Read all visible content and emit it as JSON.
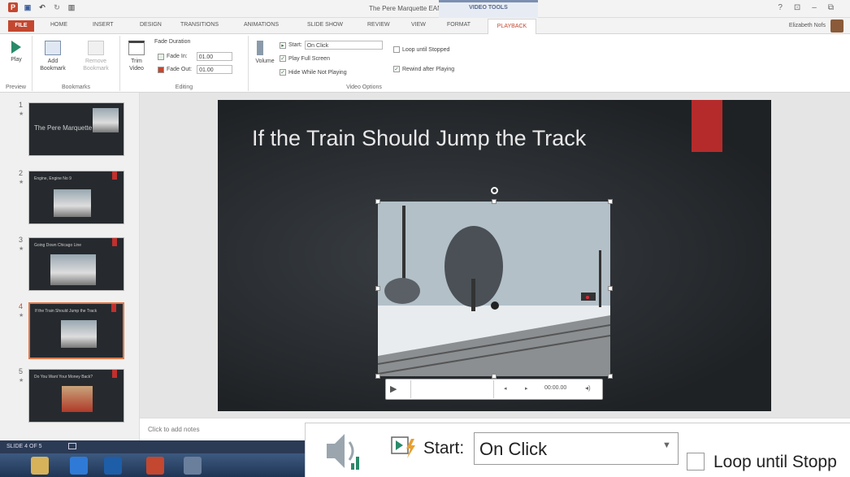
{
  "window": {
    "title": "The Pere Marquette EAN - PowerPoint",
    "contextual_tab_group": "VIDEO TOOLS",
    "user": "Elizabeth Nofs",
    "controls": [
      "?",
      "⊡",
      "–",
      "⧉"
    ]
  },
  "tabs": [
    "FILE",
    "HOME",
    "INSERT",
    "DESIGN",
    "TRANSITIONS",
    "ANIMATIONS",
    "SLIDE SHOW",
    "REVIEW",
    "VIEW",
    "FORMAT",
    "PLAYBACK"
  ],
  "active_tab": "PLAYBACK",
  "ribbon": {
    "preview": {
      "play": "Play",
      "group": "Preview"
    },
    "bookmarks": {
      "add": "Add Bookmark",
      "remove": "Remove Bookmark",
      "group": "Bookmarks"
    },
    "editing": {
      "trim": "Trim Video",
      "fade_duration": "Fade Duration",
      "fade_in_label": "Fade In:",
      "fade_in_value": "01.00",
      "fade_out_label": "Fade Out:",
      "fade_out_value": "01.00",
      "group": "Editing"
    },
    "video_options": {
      "volume": "Volume",
      "start_label": "Start:",
      "start_value": "On Click",
      "play_full_screen": "Play Full Screen",
      "hide_while_not_playing": "Hide While Not Playing",
      "loop_until_stopped": "Loop until Stopped",
      "rewind_after_playing": "Rewind after Playing",
      "group": "Video Options"
    }
  },
  "slides_pane": [
    {
      "num": "1",
      "title": "The Pere Marquette"
    },
    {
      "num": "2",
      "title": "Engine, Engine No 9"
    },
    {
      "num": "3",
      "title": "Going Down Chicago Line"
    },
    {
      "num": "4",
      "title": "If the Train Should Jump the Track"
    },
    {
      "num": "5",
      "title": "Do You Want Your Money Back?"
    }
  ],
  "selected_slide": 4,
  "slide": {
    "title": "If the Train Should Jump the Track",
    "accent_color": "#b52b2b"
  },
  "player": {
    "time": "00:00.00"
  },
  "notes_placeholder": "Click to add notes",
  "status": {
    "slide_count": "SLIDE 4 OF 5"
  },
  "zoom_callout": {
    "start_label": "Start:",
    "start_value": "On Click",
    "loop_label": "Loop until Stopp"
  }
}
